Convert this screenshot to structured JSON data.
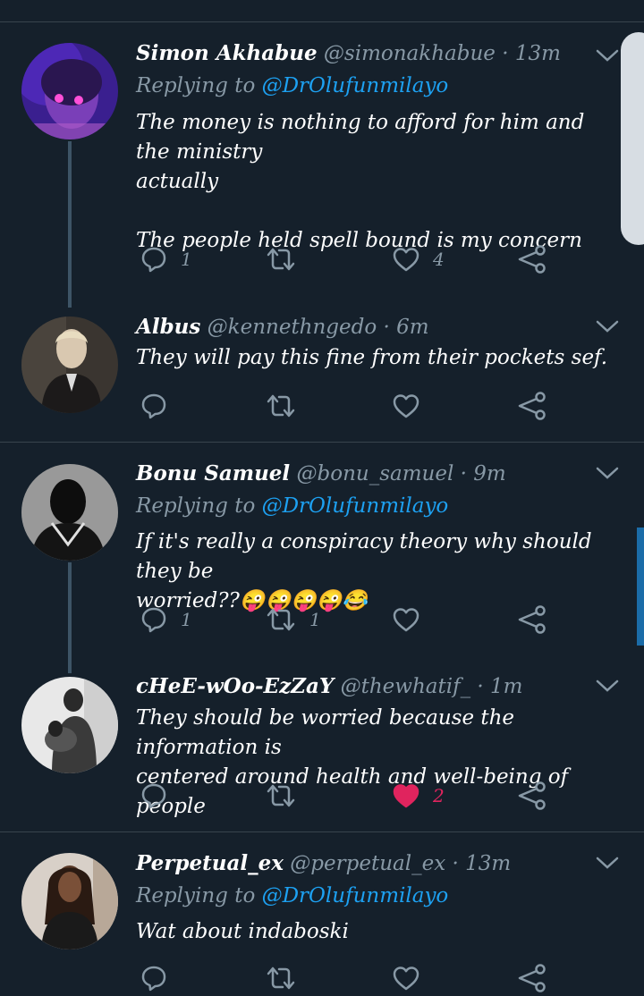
{
  "colors": {
    "background": "#15202b",
    "muted": "#8899a6",
    "link": "#1da1f2",
    "like": "#e0245e",
    "divider": "#38444d"
  },
  "tweets": [
    {
      "name": "Simon Akhabue",
      "handle": "@simonakhabue",
      "sep": "·",
      "time": "13m",
      "reply_prefix": "Replying to",
      "reply_to": "@DrOlufunmilayo",
      "text_lines": [
        "The money is nothing to afford for him and the ministry",
        "actually",
        "",
        "The people held spell bound is my concern"
      ],
      "replies": "1",
      "retweets": "",
      "likes": "4",
      "liked": false
    },
    {
      "name": "Albus",
      "handle": "@kennethngedo",
      "sep": "·",
      "time": "6m",
      "reply_prefix": "",
      "reply_to": "",
      "text_lines": [
        "They will pay this fine from their pockets sef."
      ],
      "replies": "",
      "retweets": "",
      "likes": "",
      "liked": false
    },
    {
      "name": "Bonu Samuel",
      "handle": "@bonu_samuel",
      "sep": "·",
      "time": "9m",
      "reply_prefix": "Replying to",
      "reply_to": "@DrOlufunmilayo",
      "text_lines": [
        "If it's really a conspiracy theory why should they be",
        "worried??😜😜😜😜😂"
      ],
      "replies": "1",
      "retweets": "1",
      "likes": "",
      "liked": false
    },
    {
      "name": "cHeE-wOo-EzZaY",
      "handle": "@thewhatif_",
      "sep": "·",
      "time": "1m",
      "reply_prefix": "",
      "reply_to": "",
      "text_lines": [
        "They should be worried because the information is",
        "centered around health and well-being of people"
      ],
      "replies": "",
      "retweets": "",
      "likes": "2",
      "liked": true
    },
    {
      "name": "Perpetual_ex",
      "handle": "@perpetual_ex",
      "sep": "·",
      "time": "13m",
      "reply_prefix": "Replying to",
      "reply_to": "@DrOlufunmilayo",
      "text_lines": [
        "Wat about indaboski"
      ],
      "replies": "",
      "retweets": "",
      "likes": "",
      "liked": false
    }
  ],
  "icons": [
    "reply-icon",
    "retweet-icon",
    "like-icon",
    "share-icon",
    "chevron-down-icon"
  ]
}
